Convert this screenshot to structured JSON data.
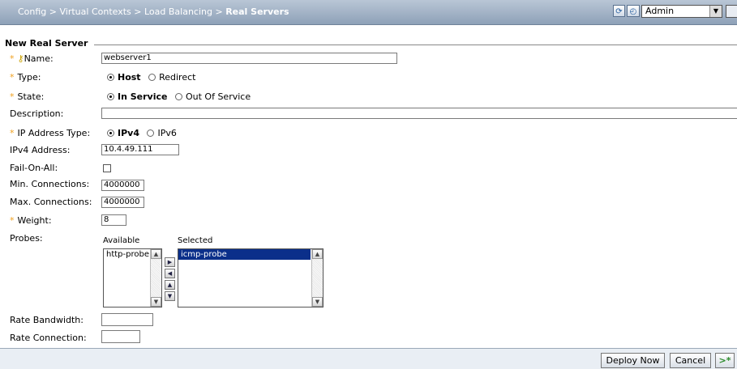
{
  "header": {
    "breadcrumb_prefix": "Config > Virtual Contexts > Load Balancing > ",
    "breadcrumb_current": "Real Servers",
    "refresh_icon": "refresh-icon",
    "context_icon": "clock-dropdown-icon",
    "context_value": "Admin"
  },
  "form": {
    "section_title": "New Real Server",
    "name": {
      "label": "Name:",
      "value": "webserver1"
    },
    "type": {
      "label": "Type:",
      "options": [
        "Host",
        "Redirect"
      ],
      "selected": "Host"
    },
    "state": {
      "label": "State:",
      "options": [
        "In Service",
        "Out Of Service"
      ],
      "selected": "In Service"
    },
    "description": {
      "label": "Description:",
      "value": ""
    },
    "ip_type": {
      "label": "IP Address Type:",
      "options": [
        "IPv4",
        "IPv6"
      ],
      "selected": "IPv4"
    },
    "ipv4": {
      "label": "IPv4 Address:",
      "value": "10.4.49.111"
    },
    "fail_on_all": {
      "label": "Fail-On-All:",
      "checked": false
    },
    "min_conn": {
      "label": "Min. Connections:",
      "value": "4000000"
    },
    "max_conn": {
      "label": "Max. Connections:",
      "value": "4000000"
    },
    "weight": {
      "label": "Weight:",
      "value": "8"
    },
    "probes": {
      "label": "Probes:",
      "available_label": "Available",
      "selected_label": "Selected",
      "available": [
        "http-probe"
      ],
      "selected": [
        "icmp-probe"
      ]
    },
    "rate_bandwidth": {
      "label": "Rate Bandwidth:",
      "value": ""
    },
    "rate_connection": {
      "label": "Rate Connection:",
      "value": ""
    }
  },
  "footer": {
    "deploy_label": "Deploy Now",
    "cancel_label": "Cancel",
    "next_label": ">*"
  }
}
